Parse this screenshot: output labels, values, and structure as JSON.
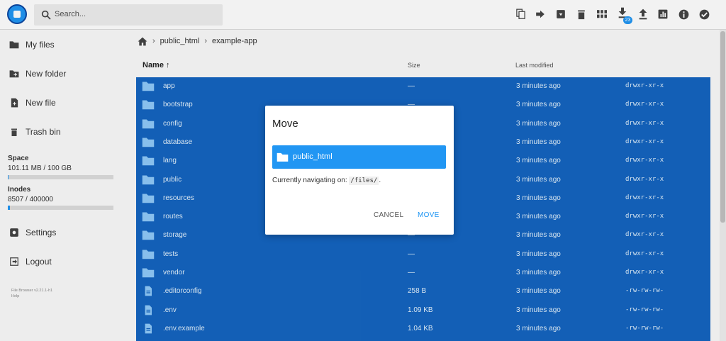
{
  "header": {
    "search_placeholder": "Search...",
    "icons": [
      "copy-icon",
      "move-icon",
      "archive-icon",
      "delete-icon",
      "grid-view-icon",
      "download-icon",
      "upload-icon",
      "info-stats-icon",
      "info-icon",
      "check-circle-icon"
    ],
    "download_badge": "23"
  },
  "sidebar": {
    "items": [
      {
        "label": "My files",
        "icon": "folder-icon"
      },
      {
        "label": "New folder",
        "icon": "new-folder-icon"
      },
      {
        "label": "New file",
        "icon": "new-file-icon"
      },
      {
        "label": "Trash bin",
        "icon": "trash-icon"
      }
    ],
    "space_label": "Space",
    "space_value": "101.11 MB / 100 GB",
    "space_fill": 0.001,
    "inodes_label": "Inodes",
    "inodes_value": "8507 / 400000",
    "inodes_fill": 0.021,
    "settings_label": "Settings",
    "logout_label": "Logout",
    "version": "File Browser v2.21.1-h1",
    "help": "Help"
  },
  "breadcrumb": {
    "items": [
      "public_html",
      "example-app"
    ]
  },
  "list": {
    "col_name": "Name",
    "col_size": "Size",
    "col_modified": "Last modified",
    "rows": [
      {
        "name": "app",
        "type": "folder",
        "size": "—",
        "modified": "3 minutes ago",
        "perm": "drwxr-xr-x"
      },
      {
        "name": "bootstrap",
        "type": "folder",
        "size": "—",
        "modified": "3 minutes ago",
        "perm": "drwxr-xr-x"
      },
      {
        "name": "config",
        "type": "folder",
        "size": "—",
        "modified": "3 minutes ago",
        "perm": "drwxr-xr-x"
      },
      {
        "name": "database",
        "type": "folder",
        "size": "—",
        "modified": "3 minutes ago",
        "perm": "drwxr-xr-x"
      },
      {
        "name": "lang",
        "type": "folder",
        "size": "—",
        "modified": "3 minutes ago",
        "perm": "drwxr-xr-x"
      },
      {
        "name": "public",
        "type": "folder",
        "size": "—",
        "modified": "3 minutes ago",
        "perm": "drwxr-xr-x"
      },
      {
        "name": "resources",
        "type": "folder",
        "size": "—",
        "modified": "3 minutes ago",
        "perm": "drwxr-xr-x"
      },
      {
        "name": "routes",
        "type": "folder",
        "size": "—",
        "modified": "3 minutes ago",
        "perm": "drwxr-xr-x"
      },
      {
        "name": "storage",
        "type": "folder",
        "size": "—",
        "modified": "3 minutes ago",
        "perm": "drwxr-xr-x"
      },
      {
        "name": "tests",
        "type": "folder",
        "size": "—",
        "modified": "3 minutes ago",
        "perm": "drwxr-xr-x"
      },
      {
        "name": "vendor",
        "type": "folder",
        "size": "—",
        "modified": "3 minutes ago",
        "perm": "drwxr-xr-x"
      },
      {
        "name": ".editorconfig",
        "type": "file",
        "size": "258 B",
        "modified": "3 minutes ago",
        "perm": "-rw-rw-rw-"
      },
      {
        "name": ".env",
        "type": "file",
        "size": "1.09 KB",
        "modified": "3 minutes ago",
        "perm": "-rw-rw-rw-"
      },
      {
        "name": ".env.example",
        "type": "file",
        "size": "1.04 KB",
        "modified": "3 minutes ago",
        "perm": "-rw-rw-rw-"
      }
    ]
  },
  "modal": {
    "title": "Move",
    "dir_item": "public_html",
    "nav_prefix": "Currently navigating on: ",
    "nav_path": "/files/",
    "nav_suffix": ".",
    "cancel_label": "CANCEL",
    "move_label": "MOVE"
  },
  "colors": {
    "accent": "#2196f3",
    "selection": "#1565c0"
  }
}
